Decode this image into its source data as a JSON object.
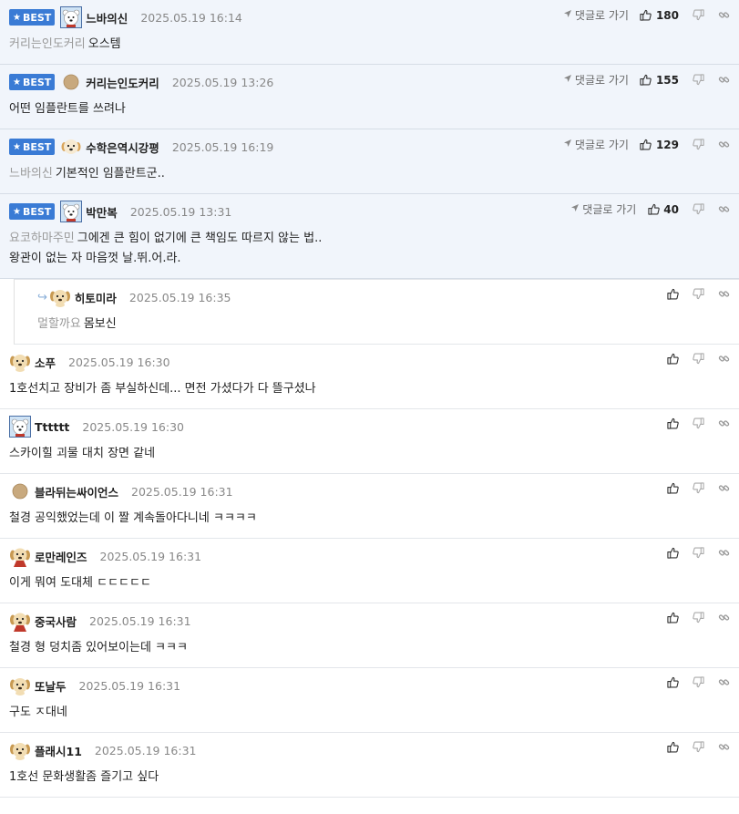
{
  "ui": {
    "goto_label": "댓글로 가기",
    "best_label": "BEST",
    "accent": "#3a7bd5"
  },
  "comments": [
    {
      "best": true,
      "avatar": "bear-icon",
      "nick": "느바의신",
      "date": "2025.05.19 16:14",
      "mention": "커리는인도커리",
      "text": "오스템",
      "likes": "180",
      "goto": true
    },
    {
      "best": true,
      "avatar": "dot-icon",
      "nick": "커리는인도커리",
      "date": "2025.05.19 13:26",
      "mention": "",
      "text": "어떤 임플란트를 쓰려나",
      "likes": "155",
      "goto": true
    },
    {
      "best": true,
      "avatar": "puppy-icon",
      "nick": "수학은역시강평",
      "date": "2025.05.19 16:19",
      "mention": "느바의신",
      "text": "기본적인 임플란트군..",
      "likes": "129",
      "goto": true
    },
    {
      "best": true,
      "avatar": "bear-icon",
      "nick": "박만복",
      "date": "2025.05.19 13:31",
      "mention": "요코하마주민",
      "text": "그에겐 큰 힘이 없기에 큰 책임도 따르지 않는 법..",
      "text2": "왕관이 없는 자 마음껏 날.뛰.어.라.",
      "likes": "40",
      "goto": true
    },
    {
      "reply": true,
      "avatar": "dog-icon",
      "nick": "히토미라",
      "date": "2025.05.19 16:35",
      "mention": "멀할까요",
      "text": "몸보신"
    },
    {
      "avatar": "dog-icon",
      "nick": "소푸",
      "date": "2025.05.19 16:30",
      "mention": "",
      "text": "1호선치고 장비가 좀 부실하신데... 면전 가셨다가 다 뜰구셨나"
    },
    {
      "avatar": "bear-icon",
      "nick": "Tttttt",
      "date": "2025.05.19 16:30",
      "mention": "",
      "text": "스카이힐 괴물 대치 장면 같네"
    },
    {
      "avatar": "dot-icon",
      "nick": "블라뒤는싸이언스",
      "date": "2025.05.19 16:31",
      "mention": "",
      "text": "철경 공익했었는데 이 짤 계속돌아다니네 ㅋㅋㅋㅋ"
    },
    {
      "avatar": "red-dog-icon",
      "nick": "로만레인즈",
      "date": "2025.05.19 16:31",
      "mention": "",
      "text": "이게 뭐여 도대체 ㄷㄷㄷㄷㄷ"
    },
    {
      "avatar": "red-dog-icon",
      "nick": "중국사람",
      "date": "2025.05.19 16:31",
      "mention": "",
      "text": "철경 형 덩치좀 있어보이는데 ㅋㅋㅋ"
    },
    {
      "avatar": "dog-icon",
      "nick": "또날두",
      "date": "2025.05.19 16:31",
      "mention": "",
      "text": "구도 ㅈ대네"
    },
    {
      "avatar": "dog-icon",
      "nick": "플래시11",
      "date": "2025.05.19 16:31",
      "mention": "",
      "text": "1호선 문화생활좀 즐기고 싶다"
    }
  ]
}
